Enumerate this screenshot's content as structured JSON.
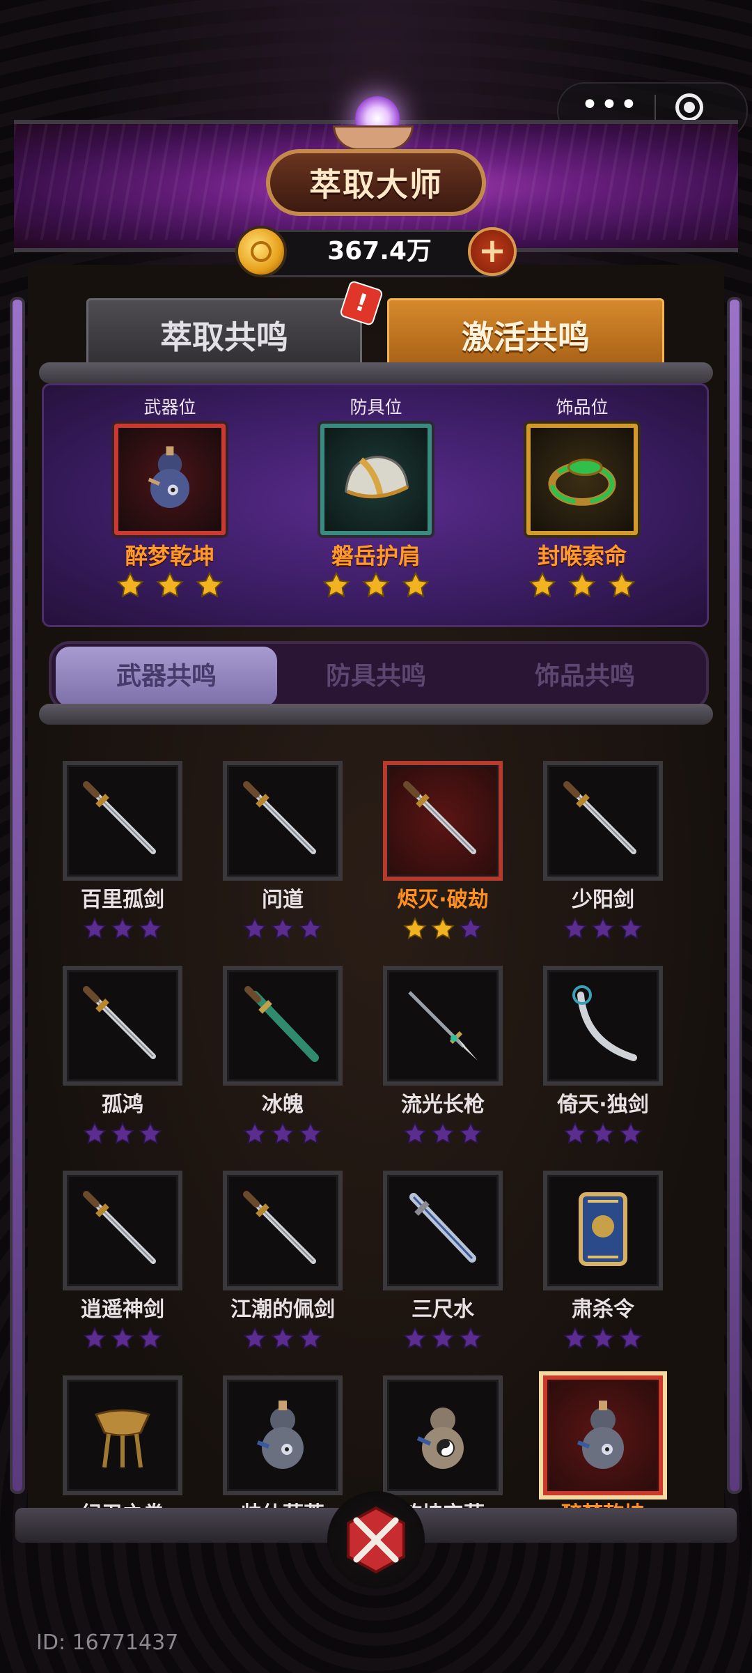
{
  "header": {
    "title": "萃取大师",
    "coins": "367.4万",
    "plus_label": "+"
  },
  "main_tabs": [
    {
      "label": "萃取共鸣",
      "active": false
    },
    {
      "label": "激活共鸣",
      "active": true
    }
  ],
  "alert_badge": "!",
  "slots": [
    {
      "position": "武器位",
      "name": "醉梦乾坤",
      "stars": 3,
      "icon": "gourd-icon",
      "frame": "red"
    },
    {
      "position": "防具位",
      "name": "磐岳护肩",
      "stars": 3,
      "icon": "helmet-icon",
      "frame": "teal"
    },
    {
      "position": "饰品位",
      "name": "封喉索命",
      "stars": 3,
      "icon": "jade-ring-icon",
      "frame": "gold"
    }
  ],
  "sub_tabs": [
    {
      "label": "武器共鸣",
      "active": true
    },
    {
      "label": "防具共鸣",
      "active": false
    },
    {
      "label": "饰品共鸣",
      "active": false
    }
  ],
  "items": [
    {
      "name": "百里孤剑",
      "stars_filled": 0,
      "icon": "sword-icon",
      "style": "normal"
    },
    {
      "name": "问道",
      "stars_filled": 0,
      "icon": "sword-icon",
      "style": "normal"
    },
    {
      "name": "烬灭·破劫",
      "stars_filled": 2,
      "icon": "sword-icon",
      "style": "red"
    },
    {
      "name": "少阳剑",
      "stars_filled": 0,
      "icon": "sword-icon",
      "style": "normal"
    },
    {
      "name": "孤鸿",
      "stars_filled": 0,
      "icon": "sword-icon",
      "style": "normal"
    },
    {
      "name": "冰魄",
      "stars_filled": 0,
      "icon": "jade-sword-icon",
      "style": "normal"
    },
    {
      "name": "流光长枪",
      "stars_filled": 0,
      "icon": "spear-icon",
      "style": "normal"
    },
    {
      "name": "倚天·独剑",
      "stars_filled": 0,
      "icon": "scimitar-icon",
      "style": "normal"
    },
    {
      "name": "逍遥神剑",
      "stars_filled": 0,
      "icon": "sword-icon",
      "style": "normal"
    },
    {
      "name": "江潮的佩剑",
      "stars_filled": 0,
      "icon": "sword-icon",
      "style": "normal"
    },
    {
      "name": "三尺水",
      "stars_filled": 0,
      "icon": "blue-sword-icon",
      "style": "normal"
    },
    {
      "name": "肃杀令",
      "stars_filled": 0,
      "icon": "token-icon",
      "style": "normal"
    },
    {
      "name": "纪卫之卷",
      "stars_filled": 0,
      "icon": "goblet-icon",
      "style": "normal"
    },
    {
      "name": "帅仙葫芦",
      "stars_filled": 0,
      "icon": "gourd-icon",
      "style": "normal"
    },
    {
      "name": "乾坤宝葫",
      "stars_filled": 0,
      "icon": "yinyang-gourd-icon",
      "style": "normal"
    },
    {
      "name": "醉梦乾坤",
      "stars_filled": 0,
      "icon": "gourd-icon",
      "style": "highlight"
    }
  ],
  "footer": {
    "id_label": "ID: 16771437"
  },
  "colors": {
    "gold_star": "#f1b322",
    "purple_star": "#5a2d8e",
    "accent_orange": "#ff8f1e"
  }
}
